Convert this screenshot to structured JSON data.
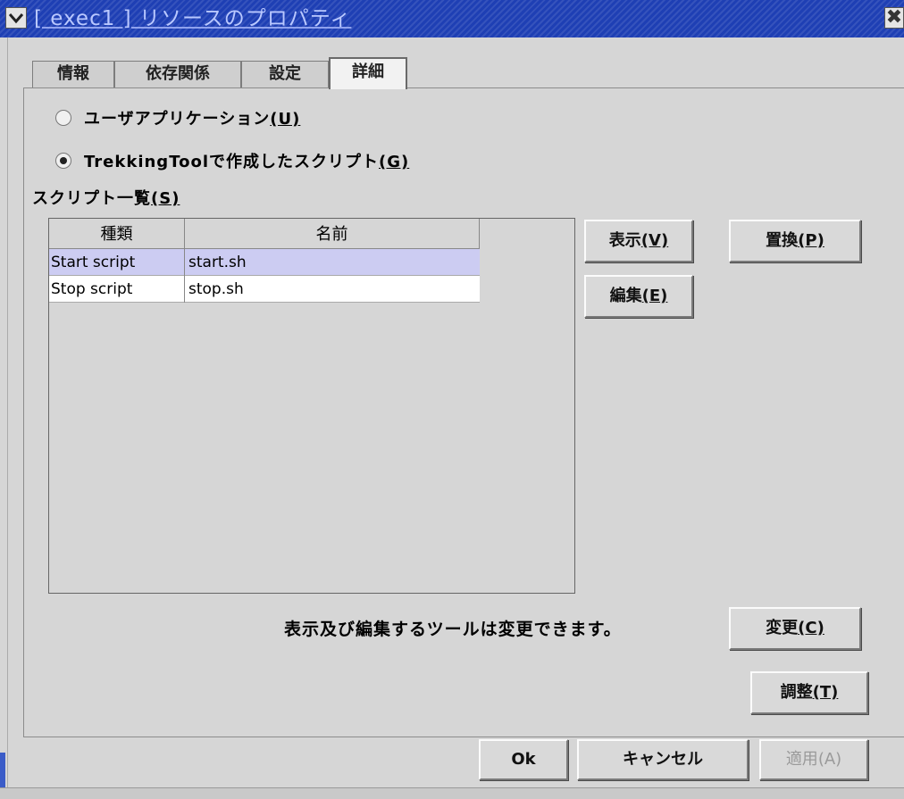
{
  "window": {
    "title": "[ exec1 ] リソースのプロパティ",
    "close_glyph": "✖"
  },
  "tabs": [
    {
      "label": "情報",
      "active": false
    },
    {
      "label": "依存関係",
      "active": false
    },
    {
      "label": "設定",
      "active": false
    },
    {
      "label": "詳細",
      "active": true
    }
  ],
  "radio_user_app": {
    "label": "ユーザアプリケーション",
    "mnemonic": "(U)",
    "checked": false
  },
  "radio_trekking": {
    "label": "TrekkingToolで作成したスクリプト",
    "mnemonic": "(G)",
    "checked": true
  },
  "script_list": {
    "label": "スクリプト一覧",
    "mnemonic": "(S)",
    "columns": [
      "種類",
      "名前"
    ],
    "rows": [
      {
        "type": "Start script",
        "name": "start.sh",
        "selected": true
      },
      {
        "type": "Stop script",
        "name": "stop.sh",
        "selected": false
      }
    ]
  },
  "buttons": {
    "view": {
      "label": "表示",
      "mnemonic": "(V)"
    },
    "replace": {
      "label": "置換",
      "mnemonic": "(P)"
    },
    "edit": {
      "label": "編集",
      "mnemonic": "(E)"
    },
    "change": {
      "label": "変更",
      "mnemonic": "(C)"
    },
    "tune": {
      "label": "調整",
      "mnemonic": "(T)"
    },
    "ok": {
      "label": "Ok"
    },
    "cancel": {
      "label": "キャンセル"
    },
    "apply": {
      "label": "適用",
      "mnemonic": "(A)",
      "enabled": false
    }
  },
  "info_text": "表示及び編集するツールは変更できます。",
  "colors": {
    "titlebar": "#1e3fb4",
    "selected_row": "#ccccf2",
    "window_bg": "#d6d6d6"
  }
}
